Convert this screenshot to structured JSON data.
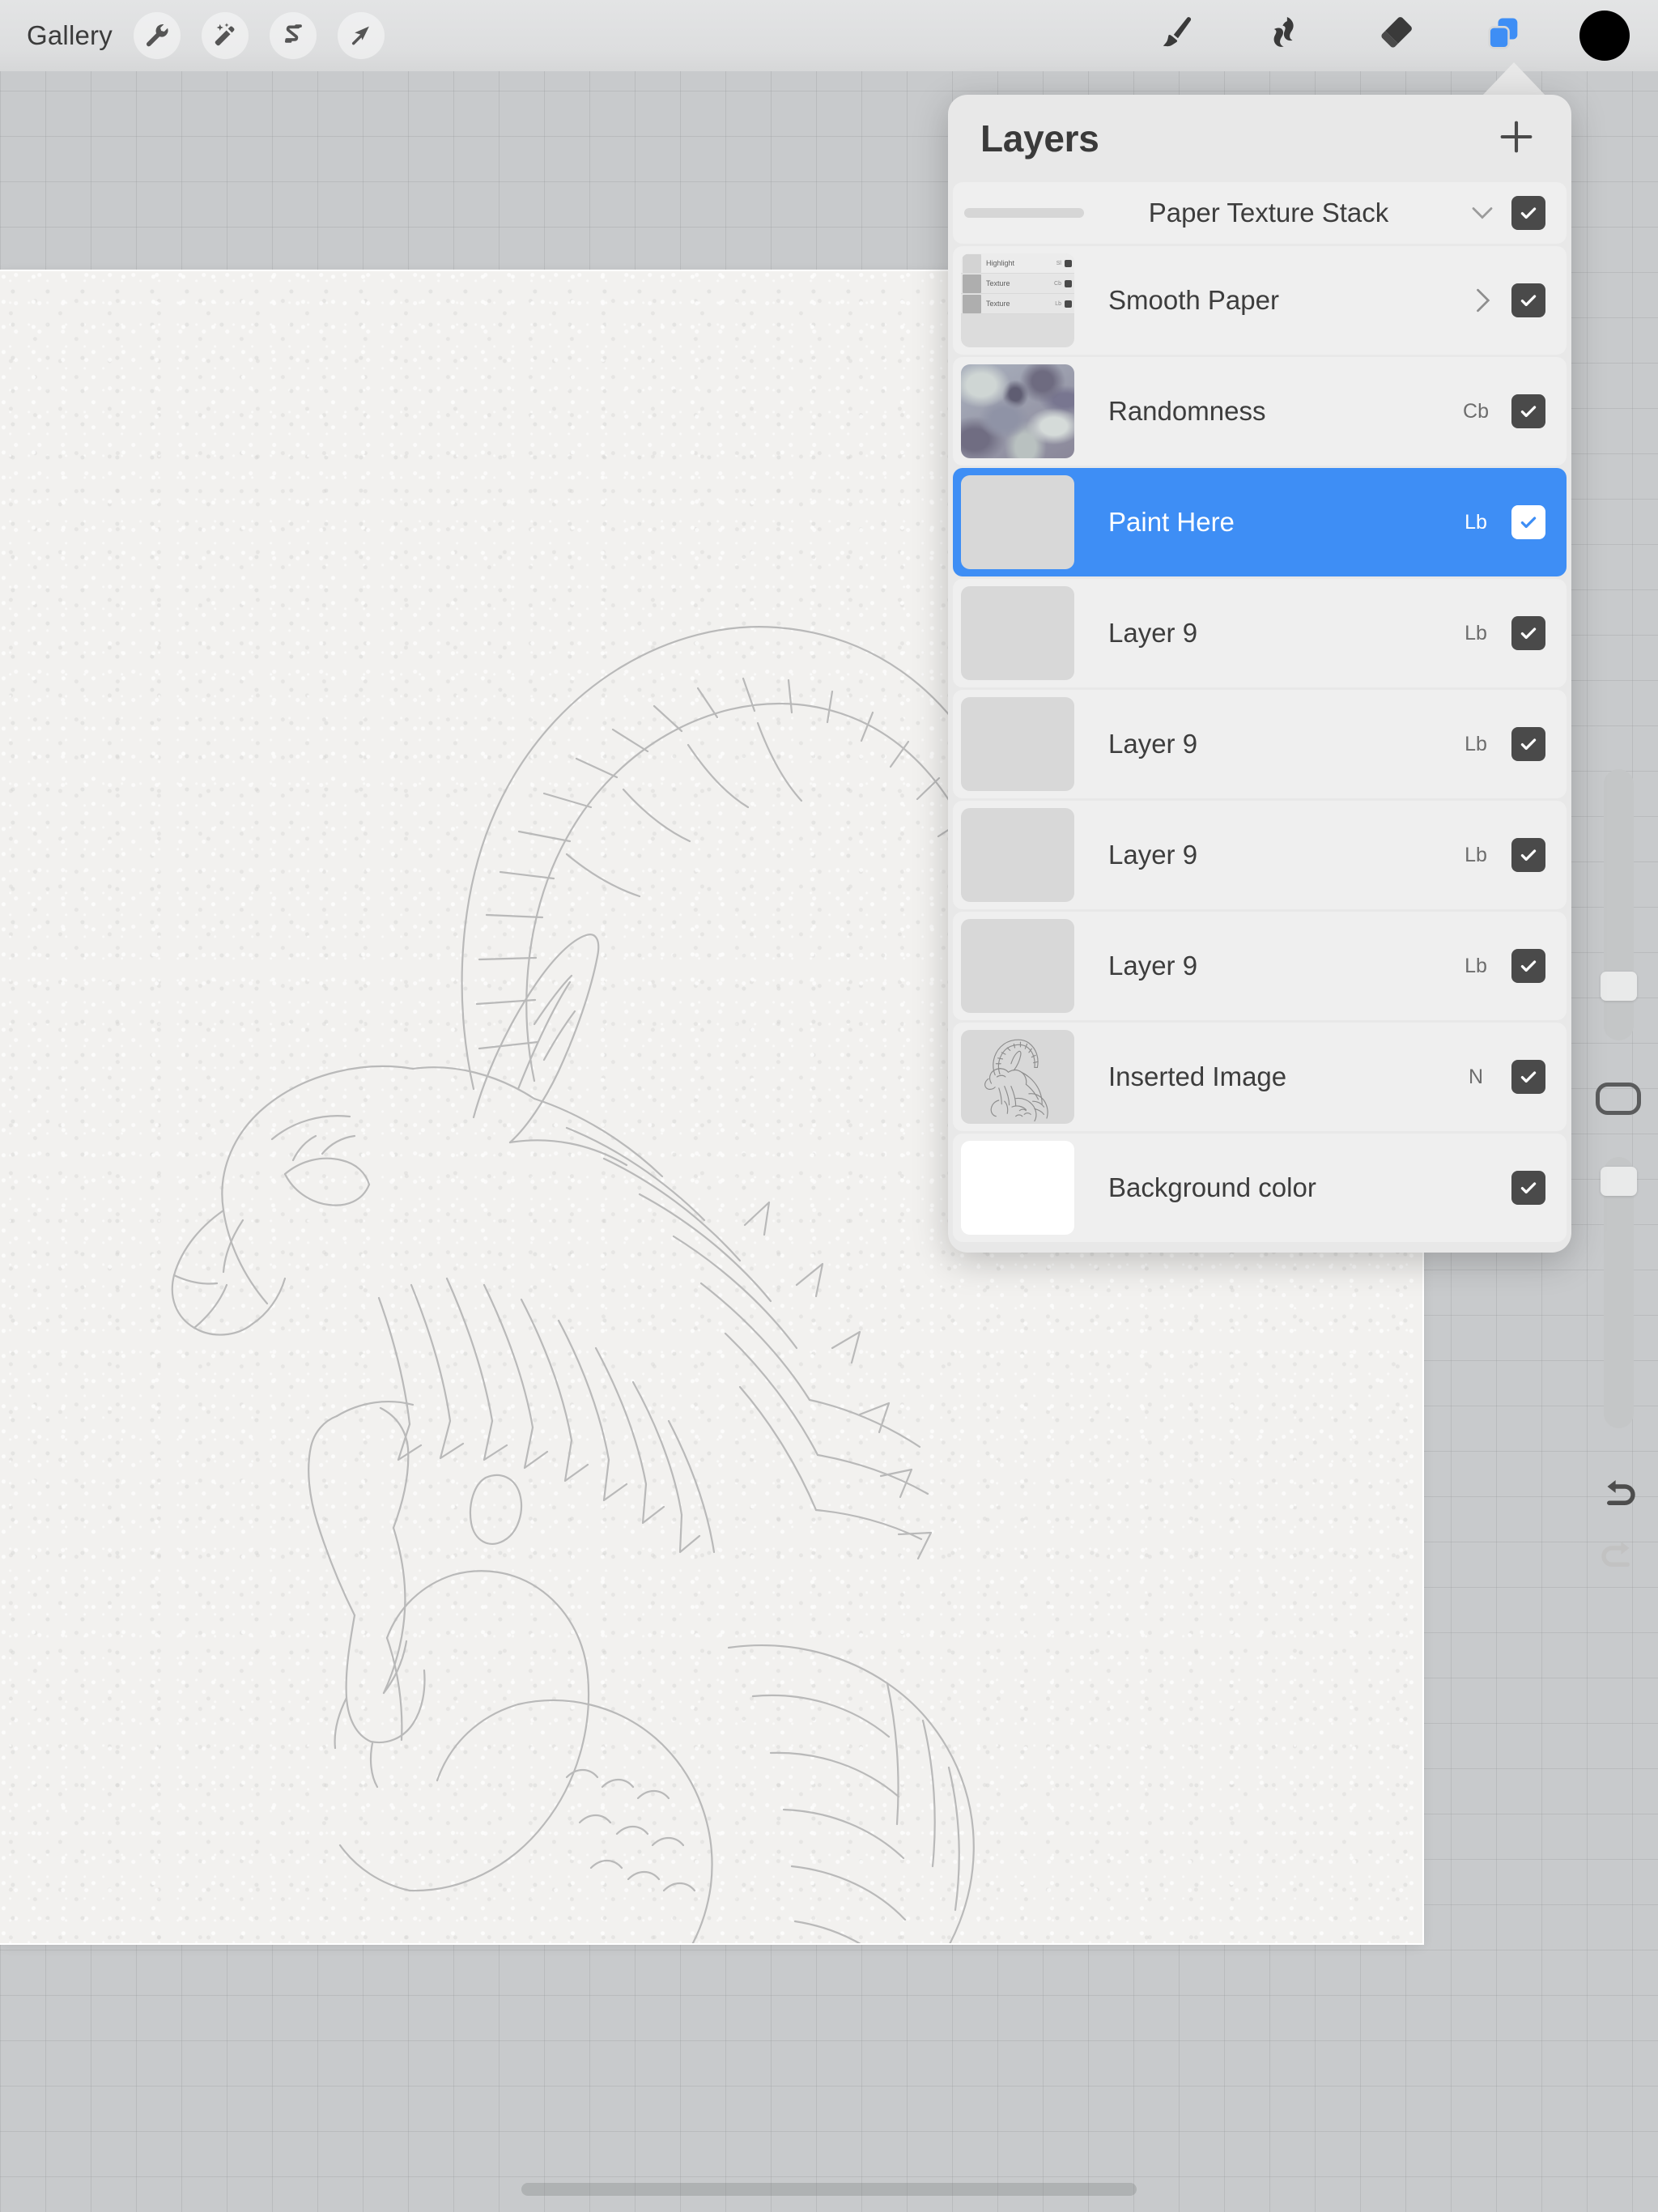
{
  "app": {
    "name": "Procreate",
    "accent_color": "#3e8ef5",
    "panel_bg": "#e8e8e8",
    "row_bg": "#efefef",
    "checkbox_color": "#4a4a4a",
    "canvas_bg": "#f3f2f0",
    "backdrop_color": "#c8cacc"
  },
  "topbar": {
    "gallery_label": "Gallery",
    "left_tools": [
      {
        "name": "adjustments-wrench-icon",
        "label": "Actions"
      },
      {
        "name": "magic-wand-icon",
        "label": "Adjustments"
      },
      {
        "name": "selection-s-icon",
        "label": "Selection"
      },
      {
        "name": "transform-arrow-icon",
        "label": "Transform"
      }
    ],
    "right_tools": [
      {
        "name": "paintbrush-icon",
        "label": "Paint",
        "active": false
      },
      {
        "name": "smudge-icon",
        "label": "Smudge",
        "active": false
      },
      {
        "name": "eraser-icon",
        "label": "Erase",
        "active": false
      },
      {
        "name": "layers-icon",
        "label": "Layers",
        "active": true
      }
    ],
    "color_swatch": "#000000"
  },
  "sidebar": {
    "brush_size_label": "Brush size",
    "brush_size_value": 22,
    "opacity_label": "Opacity",
    "opacity_value": 96,
    "modify_label": "Modify",
    "undo_label": "Undo",
    "redo_label": "Redo",
    "redo_enabled": false
  },
  "layers_panel": {
    "title": "Layers",
    "add_label": "+",
    "rows": [
      {
        "kind": "group",
        "name": "Paper Texture Stack",
        "blend": "",
        "visible": true,
        "expanded": true,
        "selected": false,
        "thumb": "group-bar"
      },
      {
        "kind": "layer",
        "name": "Smooth Paper",
        "blend": "",
        "visible": true,
        "selected": false,
        "thumb": "stack",
        "chevron": "right",
        "nested": [
          {
            "name": "Highlight",
            "blend": "Sl",
            "visible": true
          },
          {
            "name": "Texture",
            "blend": "Cb",
            "visible": true
          },
          {
            "name": "Texture",
            "blend": "Lb",
            "visible": true
          }
        ]
      },
      {
        "kind": "layer",
        "name": "Randomness",
        "blend": "Cb",
        "visible": true,
        "selected": false,
        "thumb": "noise"
      },
      {
        "kind": "layer",
        "name": "Paint Here",
        "blend": "Lb",
        "visible": true,
        "selected": true,
        "thumb": "empty"
      },
      {
        "kind": "layer",
        "name": "Layer 9",
        "blend": "Lb",
        "visible": true,
        "selected": false,
        "thumb": "empty"
      },
      {
        "kind": "layer",
        "name": "Layer 9",
        "blend": "Lb",
        "visible": true,
        "selected": false,
        "thumb": "empty"
      },
      {
        "kind": "layer",
        "name": "Layer 9",
        "blend": "Lb",
        "visible": true,
        "selected": false,
        "thumb": "empty"
      },
      {
        "kind": "layer",
        "name": "Layer 9",
        "blend": "Lb",
        "visible": true,
        "selected": false,
        "thumb": "empty"
      },
      {
        "kind": "layer",
        "name": "Inserted Image",
        "blend": "N",
        "visible": true,
        "selected": false,
        "thumb": "art"
      },
      {
        "kind": "layer",
        "name": "Background color",
        "blend": "",
        "visible": true,
        "selected": false,
        "thumb": "white"
      }
    ]
  },
  "canvas": {
    "artwork_description": "Capricorn sea-goat line art sketch",
    "line_color": "#b9b9b9"
  }
}
